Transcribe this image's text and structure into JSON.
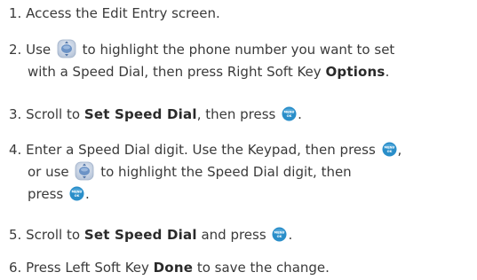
{
  "steps": [
    {
      "number": "1.",
      "lines": [
        {
          "a": "Access the Edit Entry screen."
        }
      ]
    },
    {
      "number": "2.",
      "lines": [
        {
          "a": "Use ",
          "b": " to highlight the phone number you want to set"
        },
        {
          "a": "with a Speed Dial,  then press Right Soft Key ",
          "bold": "Options",
          "c": "."
        }
      ]
    },
    {
      "number": "3.",
      "lines": [
        {
          "a": "Scroll to ",
          "bold": "Set Speed Dial",
          "c": ", then press ",
          "d": "."
        }
      ]
    },
    {
      "number": "4.",
      "lines": [
        {
          "a": "Enter a Speed Dial digit. Use the Keypad, then press ",
          "b": ","
        },
        {
          "a": "or use ",
          "b": " to highlight the Speed Dial digit, then"
        },
        {
          "a": "press ",
          "b": "."
        }
      ]
    },
    {
      "number": "5.",
      "lines": [
        {
          "a": "Scroll to ",
          "bold": "Set Speed Dial",
          "c": " and press ",
          "d": "."
        }
      ]
    },
    {
      "number": "6.",
      "lines": [
        {
          "a": "Press Left Soft Key ",
          "bold": "Done",
          "c": " to save the change."
        }
      ]
    }
  ],
  "icons": {
    "ok_button_label_top": "MENU",
    "ok_button_label_bottom": "OK",
    "ok_button_color": "#2a8ec9",
    "nav_key_color": "#6c93c6"
  }
}
